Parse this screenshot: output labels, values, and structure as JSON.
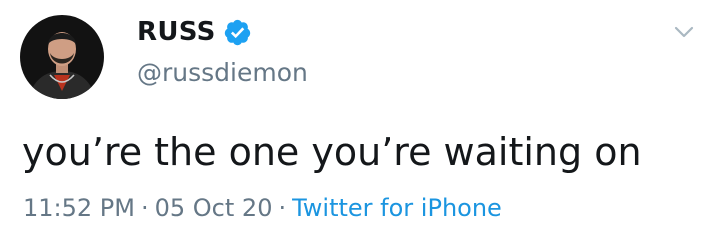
{
  "tweet": {
    "display_name": "RUSS",
    "handle": "@russdiemon",
    "text": "you’re the one you’re waiting on",
    "time": "11:52 PM",
    "separator": "·",
    "date": "05 Oct 20",
    "source": "Twitter for iPhone"
  },
  "colors": {
    "name": "#14171a",
    "secondary": "#657786",
    "link": "#1b95e0",
    "verified": "#1da1f2"
  },
  "icons": {
    "verified": "verified-badge-icon",
    "menu": "chevron-down-icon"
  }
}
